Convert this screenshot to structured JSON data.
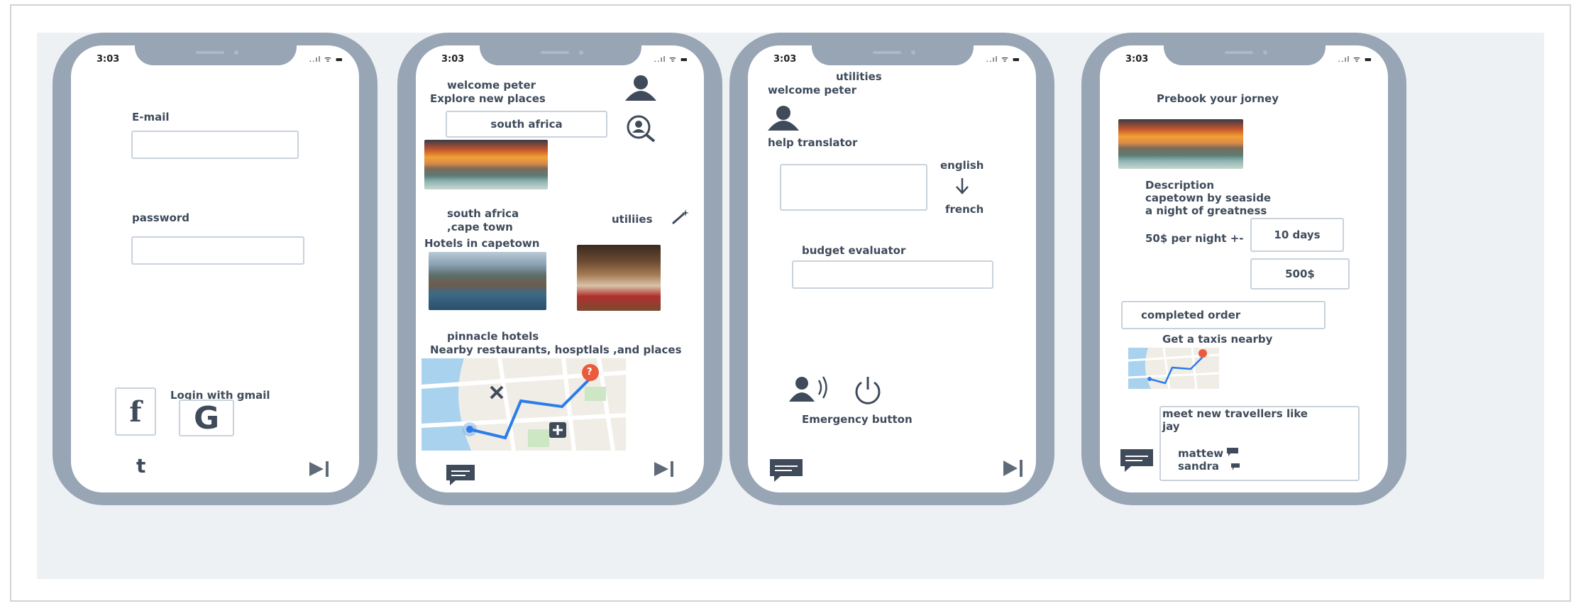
{
  "status": {
    "time": "3:03",
    "signal": "..ıl ᯤ ▬"
  },
  "screen1": {
    "email_label": "E-mail",
    "email_value": "",
    "password_label": "password",
    "password_value": "",
    "login_gmail_label": "Login with gmail",
    "facebook_glyph": "f",
    "google_glyph": "G",
    "tumblr_glyph": "t"
  },
  "screen2": {
    "welcome": "welcome peter",
    "explore": "Explore new places",
    "search_value": "south africa",
    "location_line1": "south africa",
    "location_line2": ",cape town",
    "utilities_label": "utiliies",
    "hotels_heading": "Hotels in capetown",
    "hotel_name": "pinnacle hotels",
    "nearby_heading": "Nearby restaurants, hosptlals  ,and places",
    "map_pin": "?"
  },
  "screen3": {
    "title": "utilities",
    "welcome": "welcome peter",
    "translator_label": "help translator",
    "lang_from": "english",
    "lang_to": "french",
    "budget_label": "budget evaluator",
    "budget_value": "",
    "emergency_label": "Emergency button"
  },
  "screen4": {
    "title": "Prebook your jorney",
    "desc_label": "Description",
    "desc_line1": "capetown by seaside",
    "desc_line2": "a night of greatness",
    "price": "50$ per night +-",
    "days_value": "10 days",
    "total_value": "500$",
    "order_button": "completed order",
    "taxi_label": "Get a taxis nearby",
    "travellers_line1": "meet new travellers like",
    "travellers_line2": "jay",
    "traveller_1": "mattew",
    "traveller_2": "sandra"
  }
}
